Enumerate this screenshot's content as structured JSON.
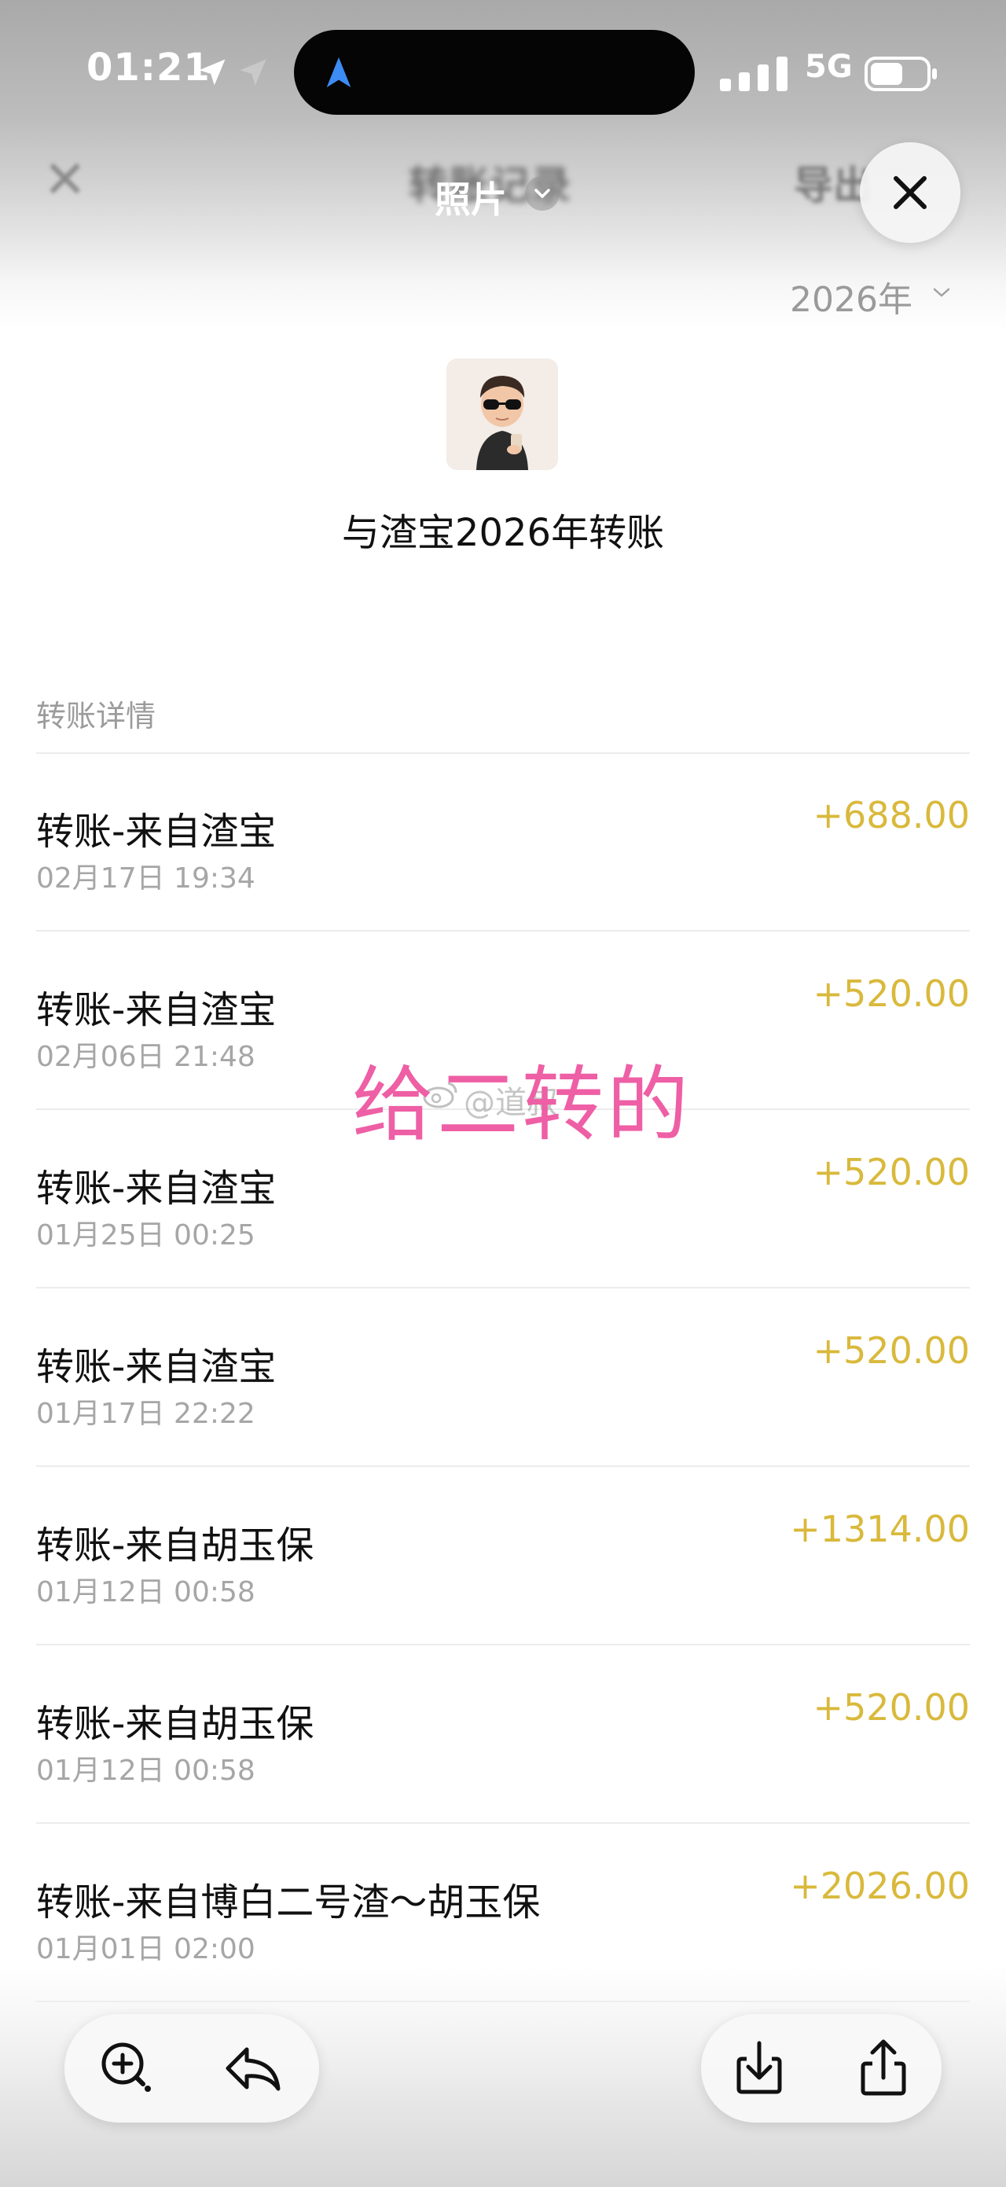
{
  "status_bar": {
    "time": "01:21",
    "network": "5G",
    "icons": [
      "location-arrow-icon",
      "navigation-arrow-icon",
      "cellular-signal-icon",
      "battery-icon"
    ]
  },
  "header": {
    "close_blurred": "✕",
    "title_blurred": "转账记录",
    "export_blurred": "导出",
    "photo_label": "照片",
    "photo_chevron_icon": "chevron-down-icon",
    "close_button_icon": "close-icon"
  },
  "year_filter": {
    "label": "2026年"
  },
  "summary": {
    "avatar_icon": "cartoon-avatar",
    "title": "与渣宝2026年转账"
  },
  "details": {
    "section_label": "转账详情",
    "amount_color": "#d9b93c",
    "items": [
      {
        "title": "转账-来自渣宝",
        "time": "02月17日 19:34",
        "amount": "+688.00"
      },
      {
        "title": "转账-来自渣宝",
        "time": "02月06日 21:48",
        "amount": "+520.00"
      },
      {
        "title": "转账-来自渣宝",
        "time": "01月25日 00:25",
        "amount": "+520.00"
      },
      {
        "title": "转账-来自渣宝",
        "time": "01月17日 22:22",
        "amount": "+520.00"
      },
      {
        "title": "转账-来自胡玉保",
        "time": "01月12日 00:58",
        "amount": "+1314.00"
      },
      {
        "title": "转账-来自胡玉保",
        "time": "01月12日 00:58",
        "amount": "+520.00"
      },
      {
        "title": "转账-来自博白二号渣～胡玉保",
        "time": "01月01日 02:00",
        "amount": "+2026.00"
      }
    ]
  },
  "overlay": {
    "annotation": "给二转的",
    "annotation_color": "#ee5fa5",
    "watermark": "@道叔"
  },
  "toolbar": {
    "icons": [
      "zoom-in-icon",
      "reply-icon",
      "download-icon",
      "share-icon"
    ]
  }
}
